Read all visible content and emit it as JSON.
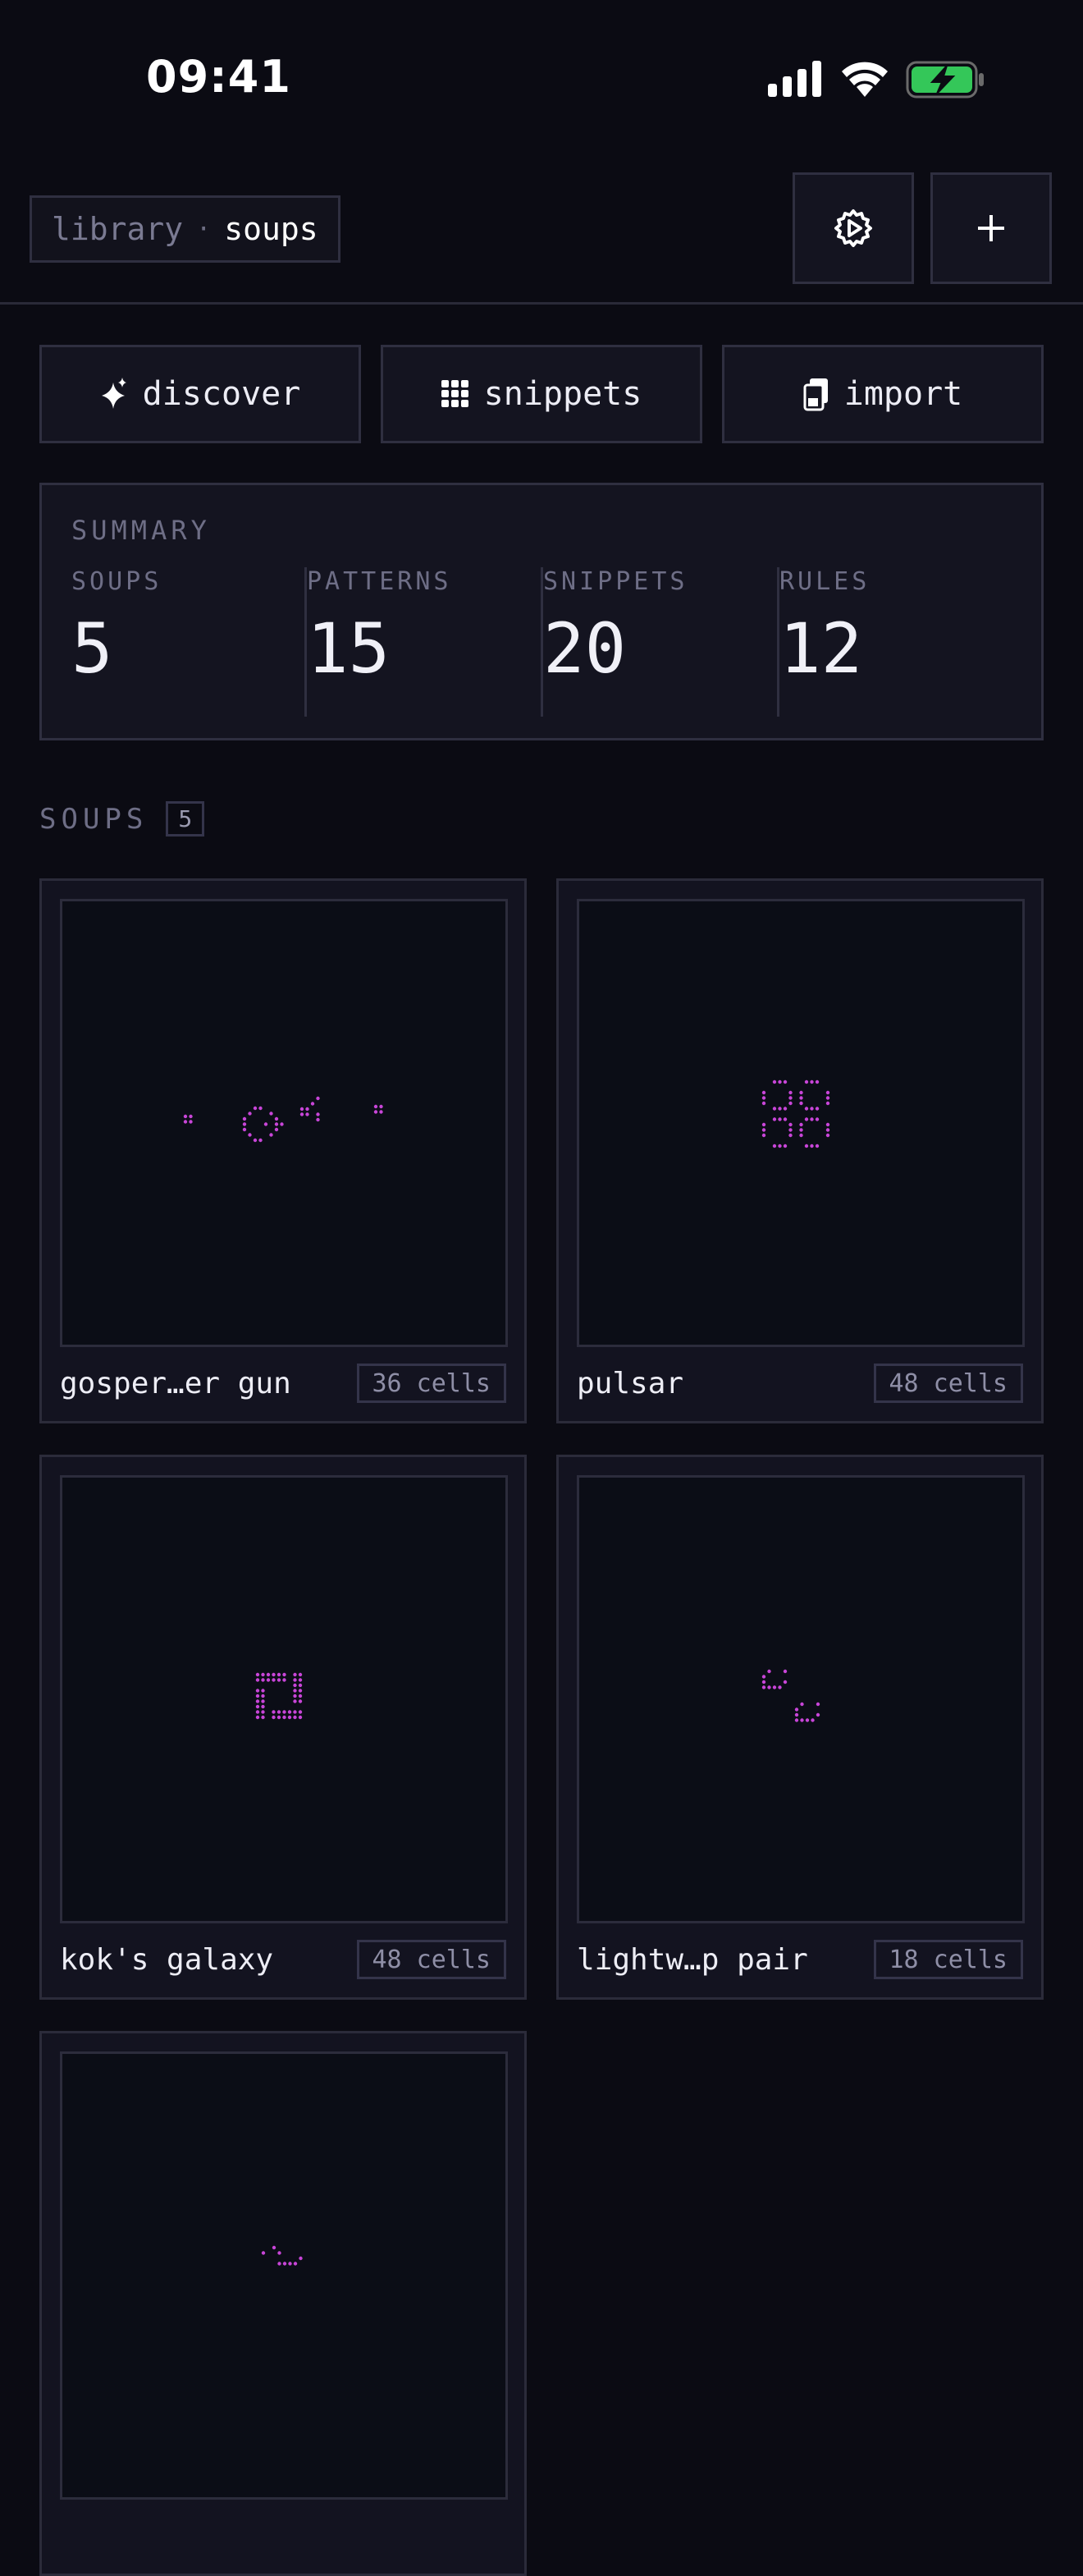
{
  "status_bar": {
    "time": "09:41"
  },
  "header": {
    "breadcrumb_root": "library",
    "breadcrumb_separator": "·",
    "breadcrumb_current": "soups",
    "settings_icon": "gear-play-icon",
    "add_label": "+"
  },
  "actions": [
    {
      "label": "discover",
      "icon": "sparkle-icon"
    },
    {
      "label": "snippets",
      "icon": "grid-icon"
    },
    {
      "label": "import",
      "icon": "clipboard-icon"
    }
  ],
  "summary": {
    "title": "SUMMARY",
    "stats": [
      {
        "label": "SOUPS",
        "value": "5"
      },
      {
        "label": "PATTERNS",
        "value": "15"
      },
      {
        "label": "SNIPPETS",
        "value": "20"
      },
      {
        "label": "RULES",
        "value": "12"
      }
    ]
  },
  "soups_section": {
    "title": "SOUPS",
    "count": "5"
  },
  "accent_color": "#c845d8",
  "cards": [
    {
      "name": "gosper…er gun",
      "cells": "36 cells",
      "pattern": "gosper-glider-gun"
    },
    {
      "name": "pulsar",
      "cells": "48 cells",
      "pattern": "pulsar"
    },
    {
      "name": "kok's galaxy",
      "cells": "48 cells",
      "pattern": "koks-galaxy"
    },
    {
      "name": "lightw…p pair",
      "cells": "18 cells",
      "pattern": "lightweight-spaceship-pair"
    },
    {
      "name": "",
      "cells": "",
      "pattern": "glider-variant"
    }
  ]
}
